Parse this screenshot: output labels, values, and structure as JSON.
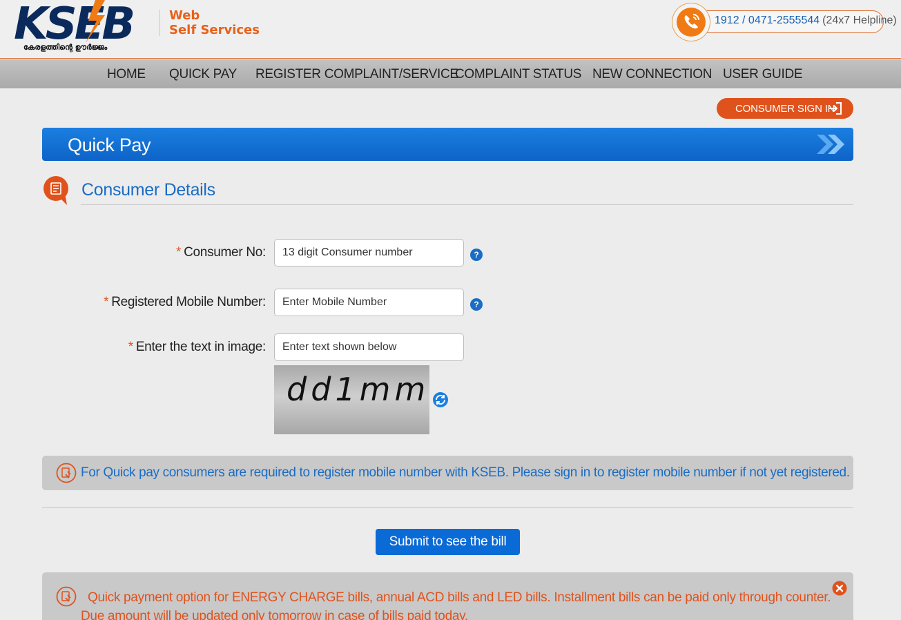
{
  "header": {
    "logo_text": "KSEB",
    "logo_tagline": "കേരളത്തിന്റെ ഊർജ്ജം",
    "sub_line1": "Web",
    "sub_line2": "Self Services",
    "helpline_number": "1912 / 0471-2555544",
    "helpline_note": "(24x7 Helpline)"
  },
  "nav": {
    "items": [
      {
        "label": "HOME"
      },
      {
        "label": "QUICK PAY"
      },
      {
        "label": "REGISTER COMPLAINT/SERVICE"
      },
      {
        "label": "COMPLAINT STATUS"
      },
      {
        "label": "NEW CONNECTION"
      },
      {
        "label": "USER GUIDE"
      }
    ]
  },
  "signin": {
    "label": "CONSUMER SIGN IN"
  },
  "banner": {
    "title": "Quick Pay"
  },
  "section": {
    "title": "Consumer Details"
  },
  "form": {
    "required_mark": "*",
    "consumer_no": {
      "label": "Consumer No:",
      "placeholder": "13 digit Consumer number",
      "value": ""
    },
    "mobile": {
      "label": "Registered Mobile Number:",
      "placeholder": "Enter Mobile Number",
      "value": ""
    },
    "captcha": {
      "label": "Enter the text in image:",
      "placeholder": "Enter text shown below",
      "value": "",
      "image_text": "dd1mm"
    },
    "help_glyph": "?"
  },
  "info": {
    "text": "For Quick pay consumers are required to register mobile number with KSEB. Please sign in to register mobile number if not yet registered."
  },
  "submit": {
    "label": "Submit to see the bill"
  },
  "notice": {
    "text": "Quick payment option for ENERGY CHARGE bills, annual ACD bills and LED bills. Installment bills can be paid only through counter. Due amount will be updated only tomorrow in case of bills paid today."
  },
  "colors": {
    "accent_orange": "#e0521c",
    "primary_blue": "#0a6ad6",
    "link_blue": "#1a6cc4",
    "nav_grey": "#b4b4b4",
    "brand_navy": "#0b2a5c"
  },
  "icons": {
    "phone": "phone-icon",
    "signin": "sign-in-icon",
    "chevrons": "double-chevron-icon",
    "section": "consumer-details-icon",
    "help": "help-icon",
    "refresh": "refresh-icon",
    "info": "info-icon",
    "close": "close-icon"
  }
}
